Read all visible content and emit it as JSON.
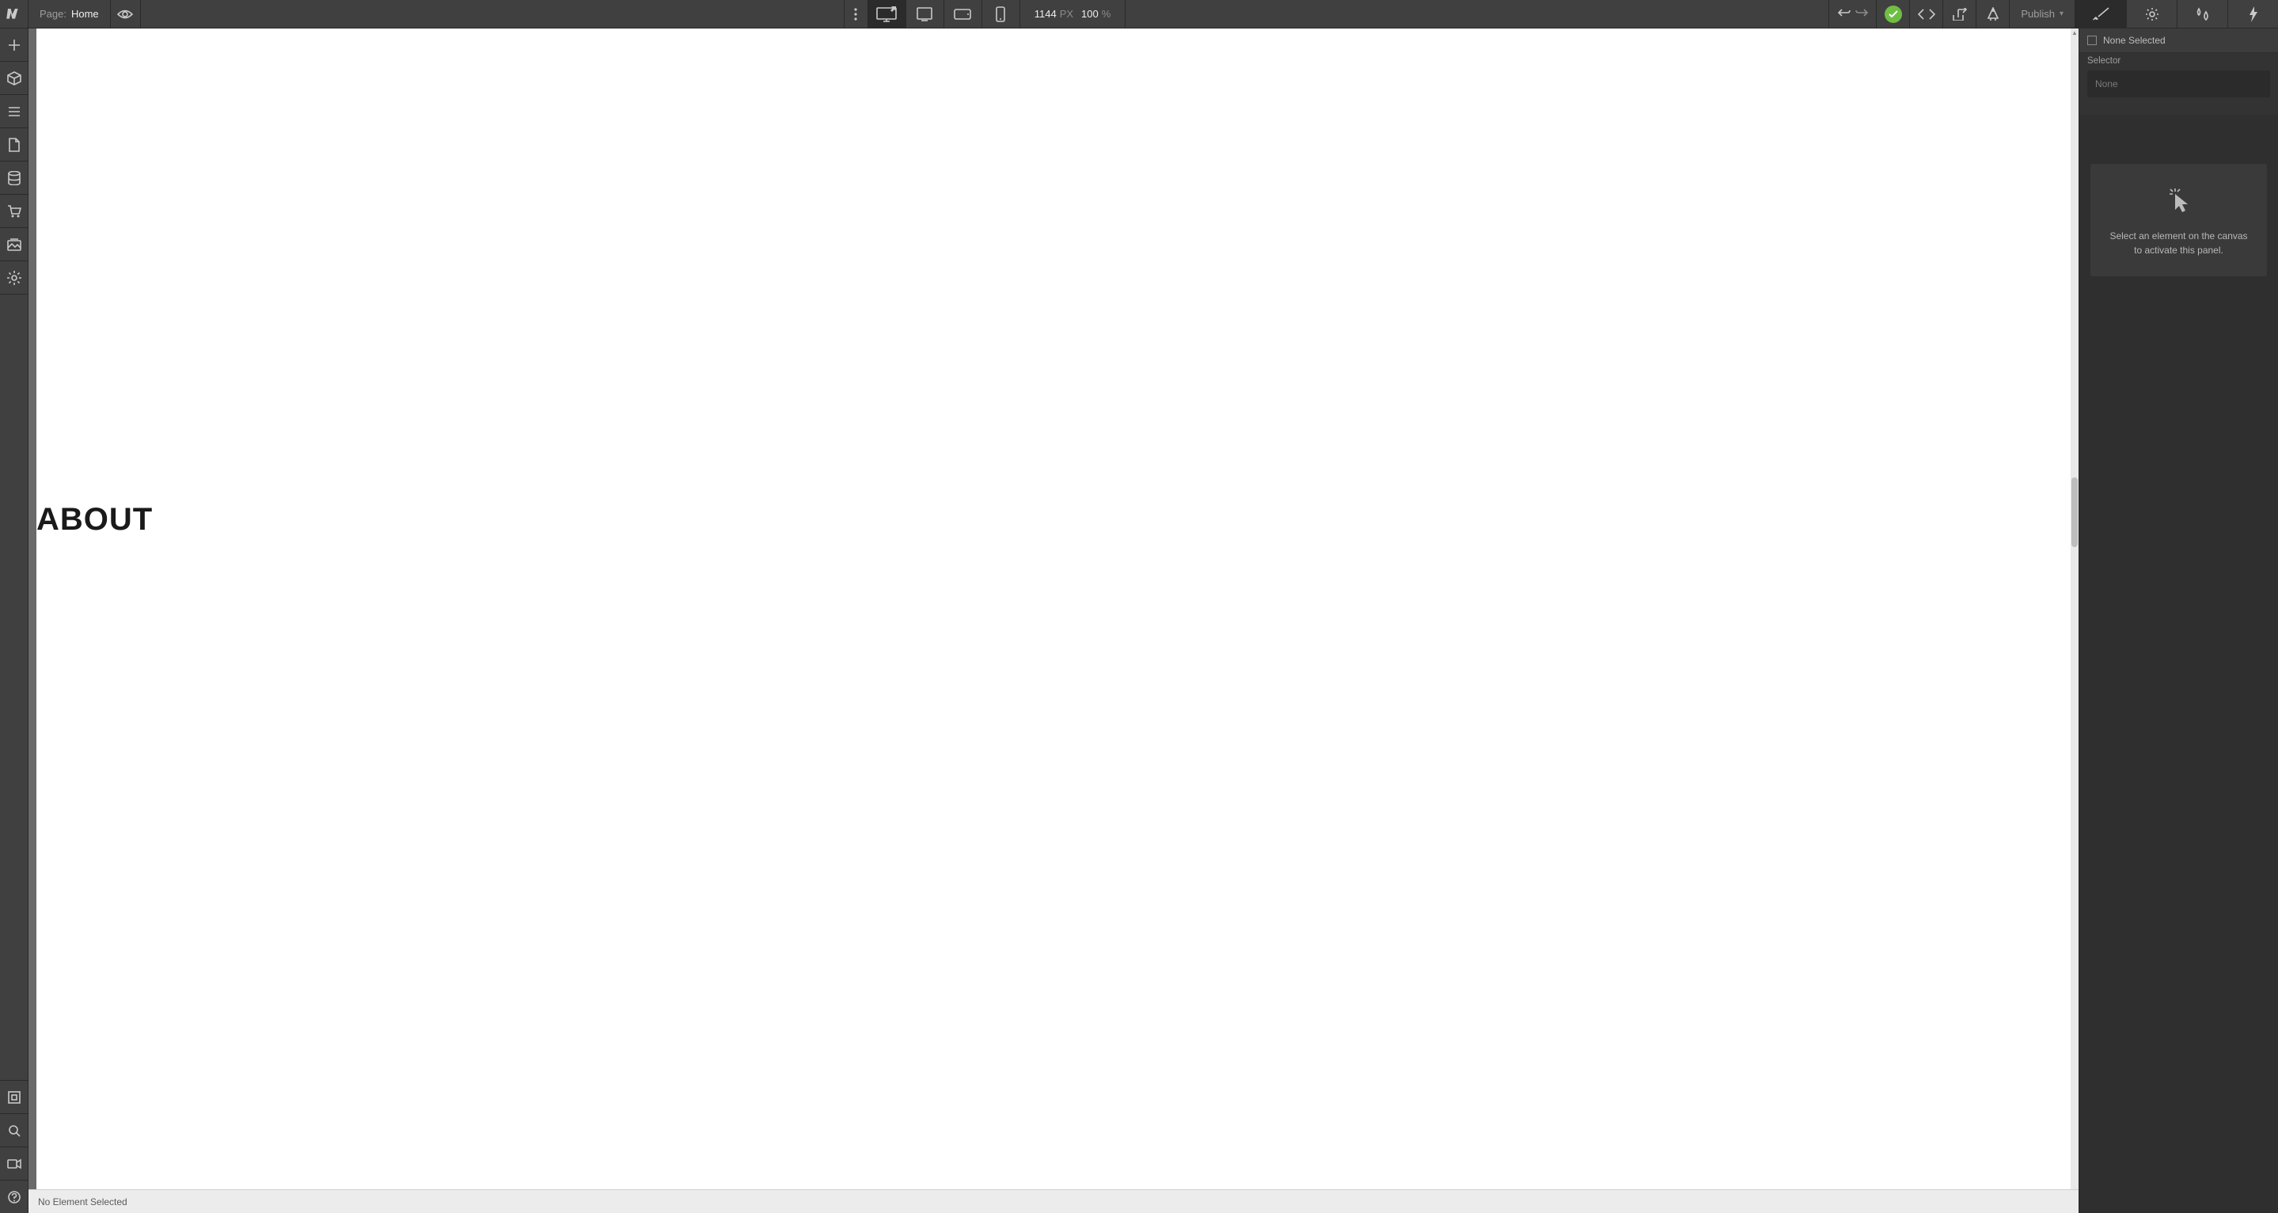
{
  "topbar": {
    "page_label": "Page:",
    "page_name": "Home",
    "width_value": "1144",
    "width_unit": "PX",
    "zoom_value": "100",
    "zoom_unit": "%",
    "publish_label": "Publish"
  },
  "devices": {
    "desktop": "Desktop (base)",
    "tablet": "Tablet",
    "phone_landscape": "Phone landscape",
    "phone_portrait": "Phone portrait"
  },
  "right_panel": {
    "selection_status": "None Selected",
    "selector_label": "Selector",
    "selector_placeholder": "None",
    "empty_message_line1": "Select an element on the canvas",
    "empty_message_line2": "to activate this panel."
  },
  "canvas": {
    "heading_text": "ABOUT"
  },
  "bottom_bar": {
    "status_text": "No Element Selected"
  },
  "icons": {
    "logo": "webflow-logo-icon",
    "preview": "eye-icon",
    "more": "more-vertical-icon",
    "undo": "undo-icon",
    "redo": "redo-icon",
    "status_ok": "checkmark-icon",
    "code": "code-icon",
    "export": "export-icon",
    "audit": "audit-icon",
    "brush": "brush-icon",
    "gear": "gear-icon",
    "droplets": "droplets-icon",
    "bolt": "bolt-icon",
    "add": "plus-icon",
    "cube": "cube-icon",
    "nav": "navigator-icon",
    "page": "page-icon",
    "db": "database-icon",
    "cart": "cart-icon",
    "assets": "assets-icon",
    "settings": "settings-icon",
    "xray": "xray-icon",
    "search": "search-icon",
    "video": "video-icon",
    "help": "help-icon",
    "pointer": "pointer-click-icon"
  }
}
